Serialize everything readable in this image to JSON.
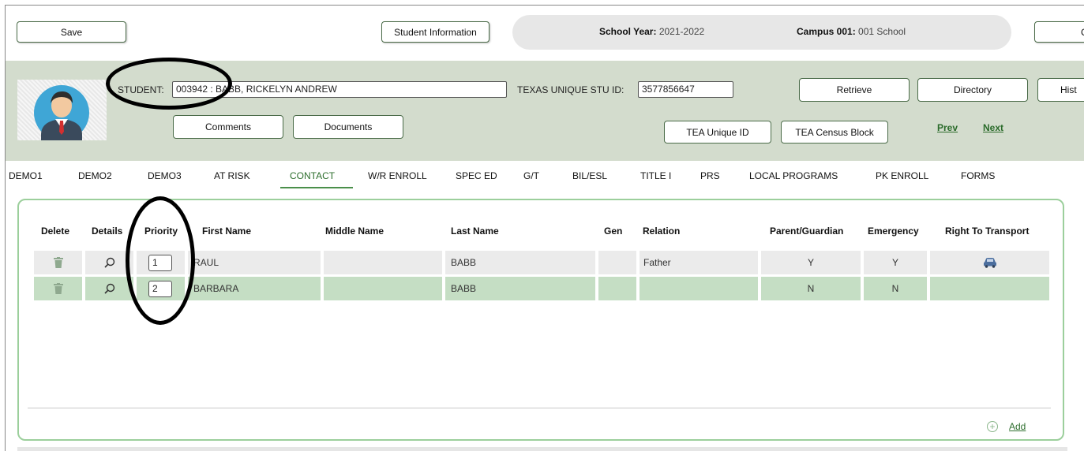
{
  "toolbar": {
    "save_label": "Save",
    "student_information_label": "Student Information",
    "right_button_label": "C"
  },
  "context": {
    "school_year_label": "School Year:",
    "school_year_value": "2021-2022",
    "campus_label": "Campus 001:",
    "campus_value": "001 School"
  },
  "student": {
    "student_label": "STUDENT:",
    "student_value": "003942 : BABB, RICKELYN ANDREW",
    "texas_id_label": "TEXAS UNIQUE STU ID:",
    "texas_id_value": "3577856647",
    "retrieve_label": "Retrieve",
    "directory_label": "Directory",
    "history_label": "Hist",
    "comments_label": "Comments",
    "documents_label": "Documents",
    "tea_unique_id_label": "TEA Unique ID",
    "tea_census_block_label": "TEA Census Block",
    "prev_label": "Prev",
    "next_label": "Next"
  },
  "tabs": [
    {
      "label": "DEMO1"
    },
    {
      "label": "DEMO2"
    },
    {
      "label": "DEMO3"
    },
    {
      "label": "AT RISK"
    },
    {
      "label": "CONTACT",
      "active": true
    },
    {
      "label": "W/R ENROLL"
    },
    {
      "label": "SPEC ED"
    },
    {
      "label": "G/T"
    },
    {
      "label": "BIL/ESL"
    },
    {
      "label": "TITLE I"
    },
    {
      "label": "PRS"
    },
    {
      "label": "LOCAL PROGRAMS"
    },
    {
      "label": "PK ENROLL"
    },
    {
      "label": "FORMS"
    }
  ],
  "contacts": {
    "columns": [
      "Delete",
      "Details",
      "Priority",
      "First Name",
      "Middle Name",
      "Last Name",
      "Gen",
      "Relation",
      "Parent/Guardian",
      "Emergency",
      "Right To Transport"
    ],
    "rows": [
      {
        "priority": "1",
        "first_name": "RAUL",
        "middle_name": "",
        "last_name": "BABB",
        "gen": "",
        "relation": "Father",
        "parent_guardian": "Y",
        "emergency": "Y",
        "transport_icon": "car-icon"
      },
      {
        "priority": "2",
        "first_name": "BARBARA",
        "middle_name": "",
        "last_name": "BABB",
        "gen": "",
        "relation": "",
        "parent_guardian": "N",
        "emergency": "N",
        "transport_icon": ""
      }
    ],
    "add_label": "Add"
  },
  "colors": {
    "header_bg": "#d3dccd",
    "panel_border": "#9ccf9c",
    "row_alt": "#c5dec4",
    "accent": "#2d6e2d"
  }
}
